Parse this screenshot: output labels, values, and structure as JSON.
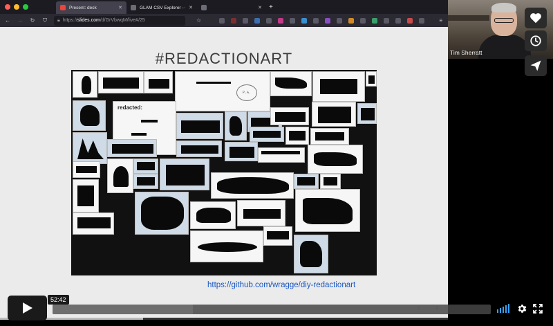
{
  "browser": {
    "tabs": [
      {
        "label": "Present: deck",
        "active": true,
        "favicon_color": "#e8453c"
      },
      {
        "label": "GLAM CSV Explorer - GLAM W",
        "active": false,
        "favicon_color": "#6c6c77"
      },
      {
        "label": "",
        "active": false,
        "favicon_color": "#6c6c77"
      }
    ],
    "url": {
      "prefix": "https://",
      "host": "slides.com",
      "path": "/d/GrVbwqM/live#/25"
    },
    "colors": {
      "close": "#ff5f57",
      "minimize": "#febc2e",
      "maximize": "#28c840"
    }
  },
  "slide": {
    "title": "#REDACTIONART",
    "link": "https://github.com/wragge/diy-redactionart",
    "definition_title": "redacted:",
    "definition_text": "[obscured definition text]"
  },
  "webcam": {
    "name": "Tim Sherratt"
  },
  "side_buttons": [
    {
      "icon": "heart-icon"
    },
    {
      "icon": "clock-icon"
    },
    {
      "icon": "send-icon"
    }
  ],
  "player": {
    "timecode": "52:42",
    "progress": 0.32,
    "volume_color": "#36a3ff"
  }
}
